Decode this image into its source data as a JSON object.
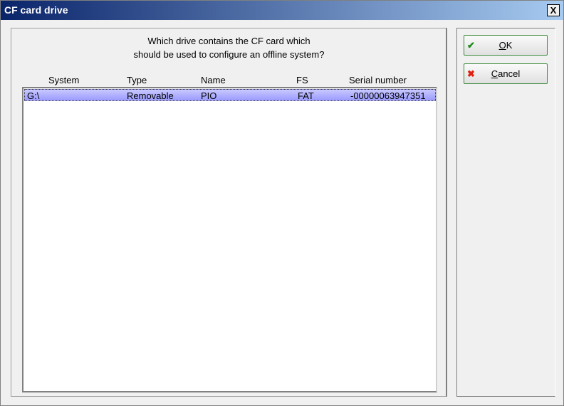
{
  "window": {
    "title": "CF card drive",
    "close_label": "X"
  },
  "question": {
    "line1": "Which drive contains the CF card which",
    "line2": "should be used to configure an offline system?"
  },
  "columns": [
    "System",
    "Type",
    "Name",
    "FS",
    "Serial number"
  ],
  "rows": [
    {
      "system": "G:\\",
      "type": "Removable",
      "name": "PIO",
      "fs": "FAT",
      "serial": "-00000063947351"
    }
  ],
  "buttons": {
    "ok": {
      "mnemonic": "O",
      "rest": "K"
    },
    "cancel": {
      "mnemonic": "C",
      "rest": "ancel"
    }
  }
}
